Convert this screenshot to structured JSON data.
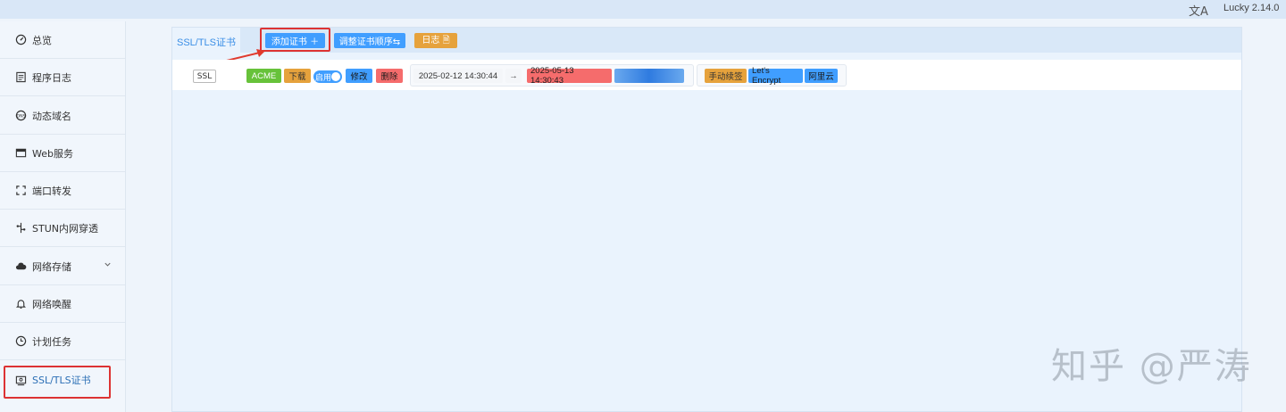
{
  "topbar": {
    "lang_icon": "文A",
    "version": "Lucky 2.14.0"
  },
  "sidebar": {
    "items": [
      {
        "label": "总览",
        "icon": "dashboard-icon"
      },
      {
        "label": "程序日志",
        "icon": "log-icon"
      },
      {
        "label": "动态域名",
        "icon": "dns-icon"
      },
      {
        "label": "Web服务",
        "icon": "web-icon"
      },
      {
        "label": "端口转发",
        "icon": "forward-icon"
      },
      {
        "label": "STUN内网穿透",
        "icon": "stun-icon"
      },
      {
        "label": "网络存储",
        "icon": "cloud-icon"
      },
      {
        "label": "网络唤醒",
        "icon": "bell-icon"
      },
      {
        "label": "计划任务",
        "icon": "clock-icon"
      },
      {
        "label": "SSL/TLS证书",
        "icon": "certificate-icon"
      }
    ]
  },
  "main": {
    "tab_label": "SSL/TLS证书",
    "toolbar": {
      "add_label": "添加证书 ＋",
      "reorder_label": "调整证书顺序⇆",
      "log_label": "日志 🗎"
    },
    "cert_row": {
      "type": "SSL",
      "source": "ACME",
      "download": "下载",
      "enable": "启用",
      "edit": "修改",
      "delete": "删除",
      "issued": "2025-02-12 14:30:44",
      "arrow": "→",
      "expires": "2025-05-13 14:30:43",
      "renew": "手动续签",
      "ca": "Let's Encrypt",
      "dns_provider": "阿里云"
    }
  },
  "watermark": "知乎 @严涛",
  "colors": {
    "primary": "#409eff",
    "success": "#67c23a",
    "warning": "#e6a23c",
    "danger": "#f56c6c",
    "highlight": "#dd3333"
  }
}
